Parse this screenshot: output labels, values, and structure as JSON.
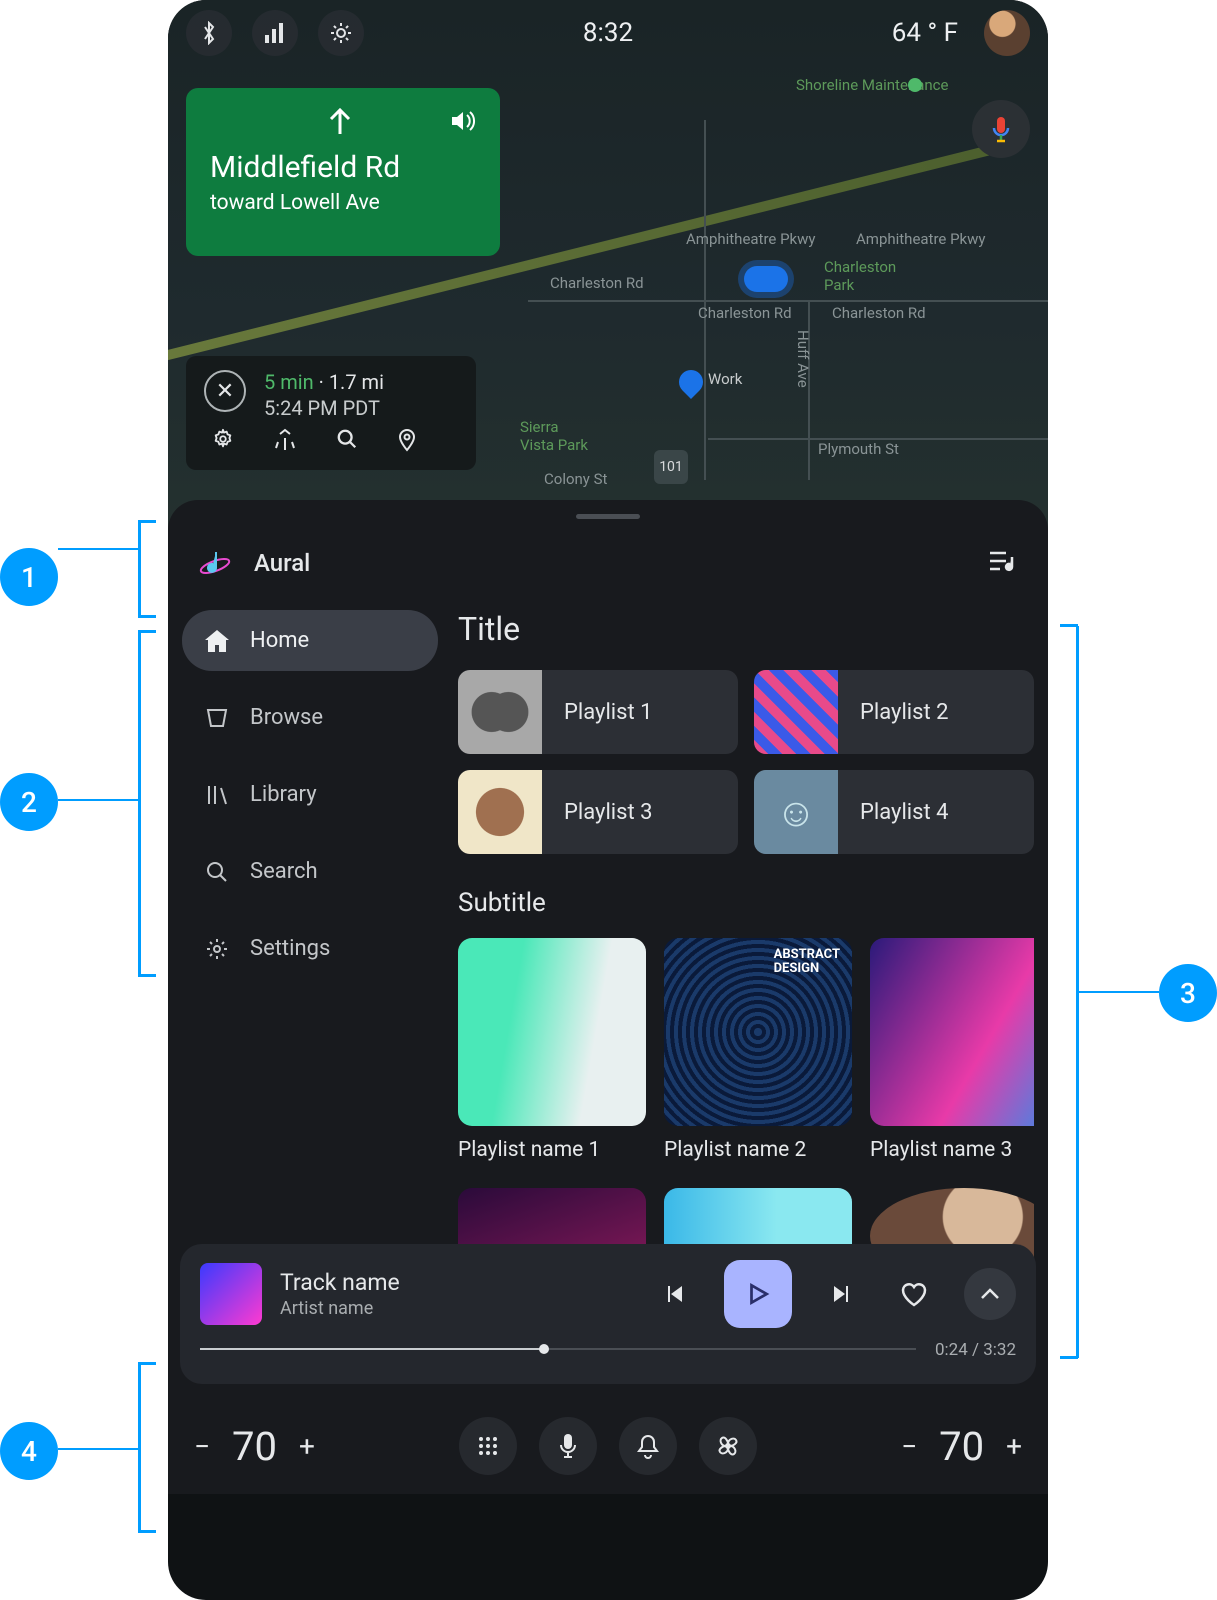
{
  "status": {
    "time": "8:32",
    "temp": "64 ° F"
  },
  "map": {
    "nav_card": {
      "street": "Middlefield Rd",
      "toward": "toward Lowell Ave"
    },
    "eta": {
      "minutes": "5 min",
      "sep": " · ",
      "distance": "1.7 mi",
      "arrival": "5:24 PM PDT"
    },
    "labels": {
      "amphitheatre1": "Amphitheatre Pkwy",
      "amphitheatre2": "Amphitheatre Pkwy",
      "charleston_road": "Charleston Rd",
      "charleston_park": "Charleston\nPark",
      "shoreline": "Shoreline Maintenance",
      "huff": "Huff Ave",
      "plymouth": "Plymouth St",
      "colony": "Colony St",
      "sierra": "Sierra\nVista Park",
      "route": "101",
      "work": "Work"
    }
  },
  "app": {
    "name": "Aural",
    "nav": {
      "home": "Home",
      "browse": "Browse",
      "library": "Library",
      "search": "Search",
      "settings": "Settings"
    },
    "section1_title": "Title",
    "playlists_row": [
      {
        "label": "Playlist 1"
      },
      {
        "label": "Playlist 2"
      },
      {
        "label": "Playlist 3"
      },
      {
        "label": "Playlist 4"
      }
    ],
    "section2_title": "Subtitle",
    "cards": [
      {
        "label": "Playlist name 1"
      },
      {
        "label": "Playlist name 2"
      },
      {
        "label": "Playlist name 3"
      }
    ]
  },
  "now_playing": {
    "track": "Track name",
    "artist": "Artist name",
    "elapsed": "0:24",
    "sep": " / ",
    "total": "3:32",
    "progress_pct": 48
  },
  "climate": {
    "left_temp": "70",
    "right_temp": "70"
  },
  "annotations": {
    "one": "1",
    "two": "2",
    "three": "3",
    "four": "4"
  }
}
